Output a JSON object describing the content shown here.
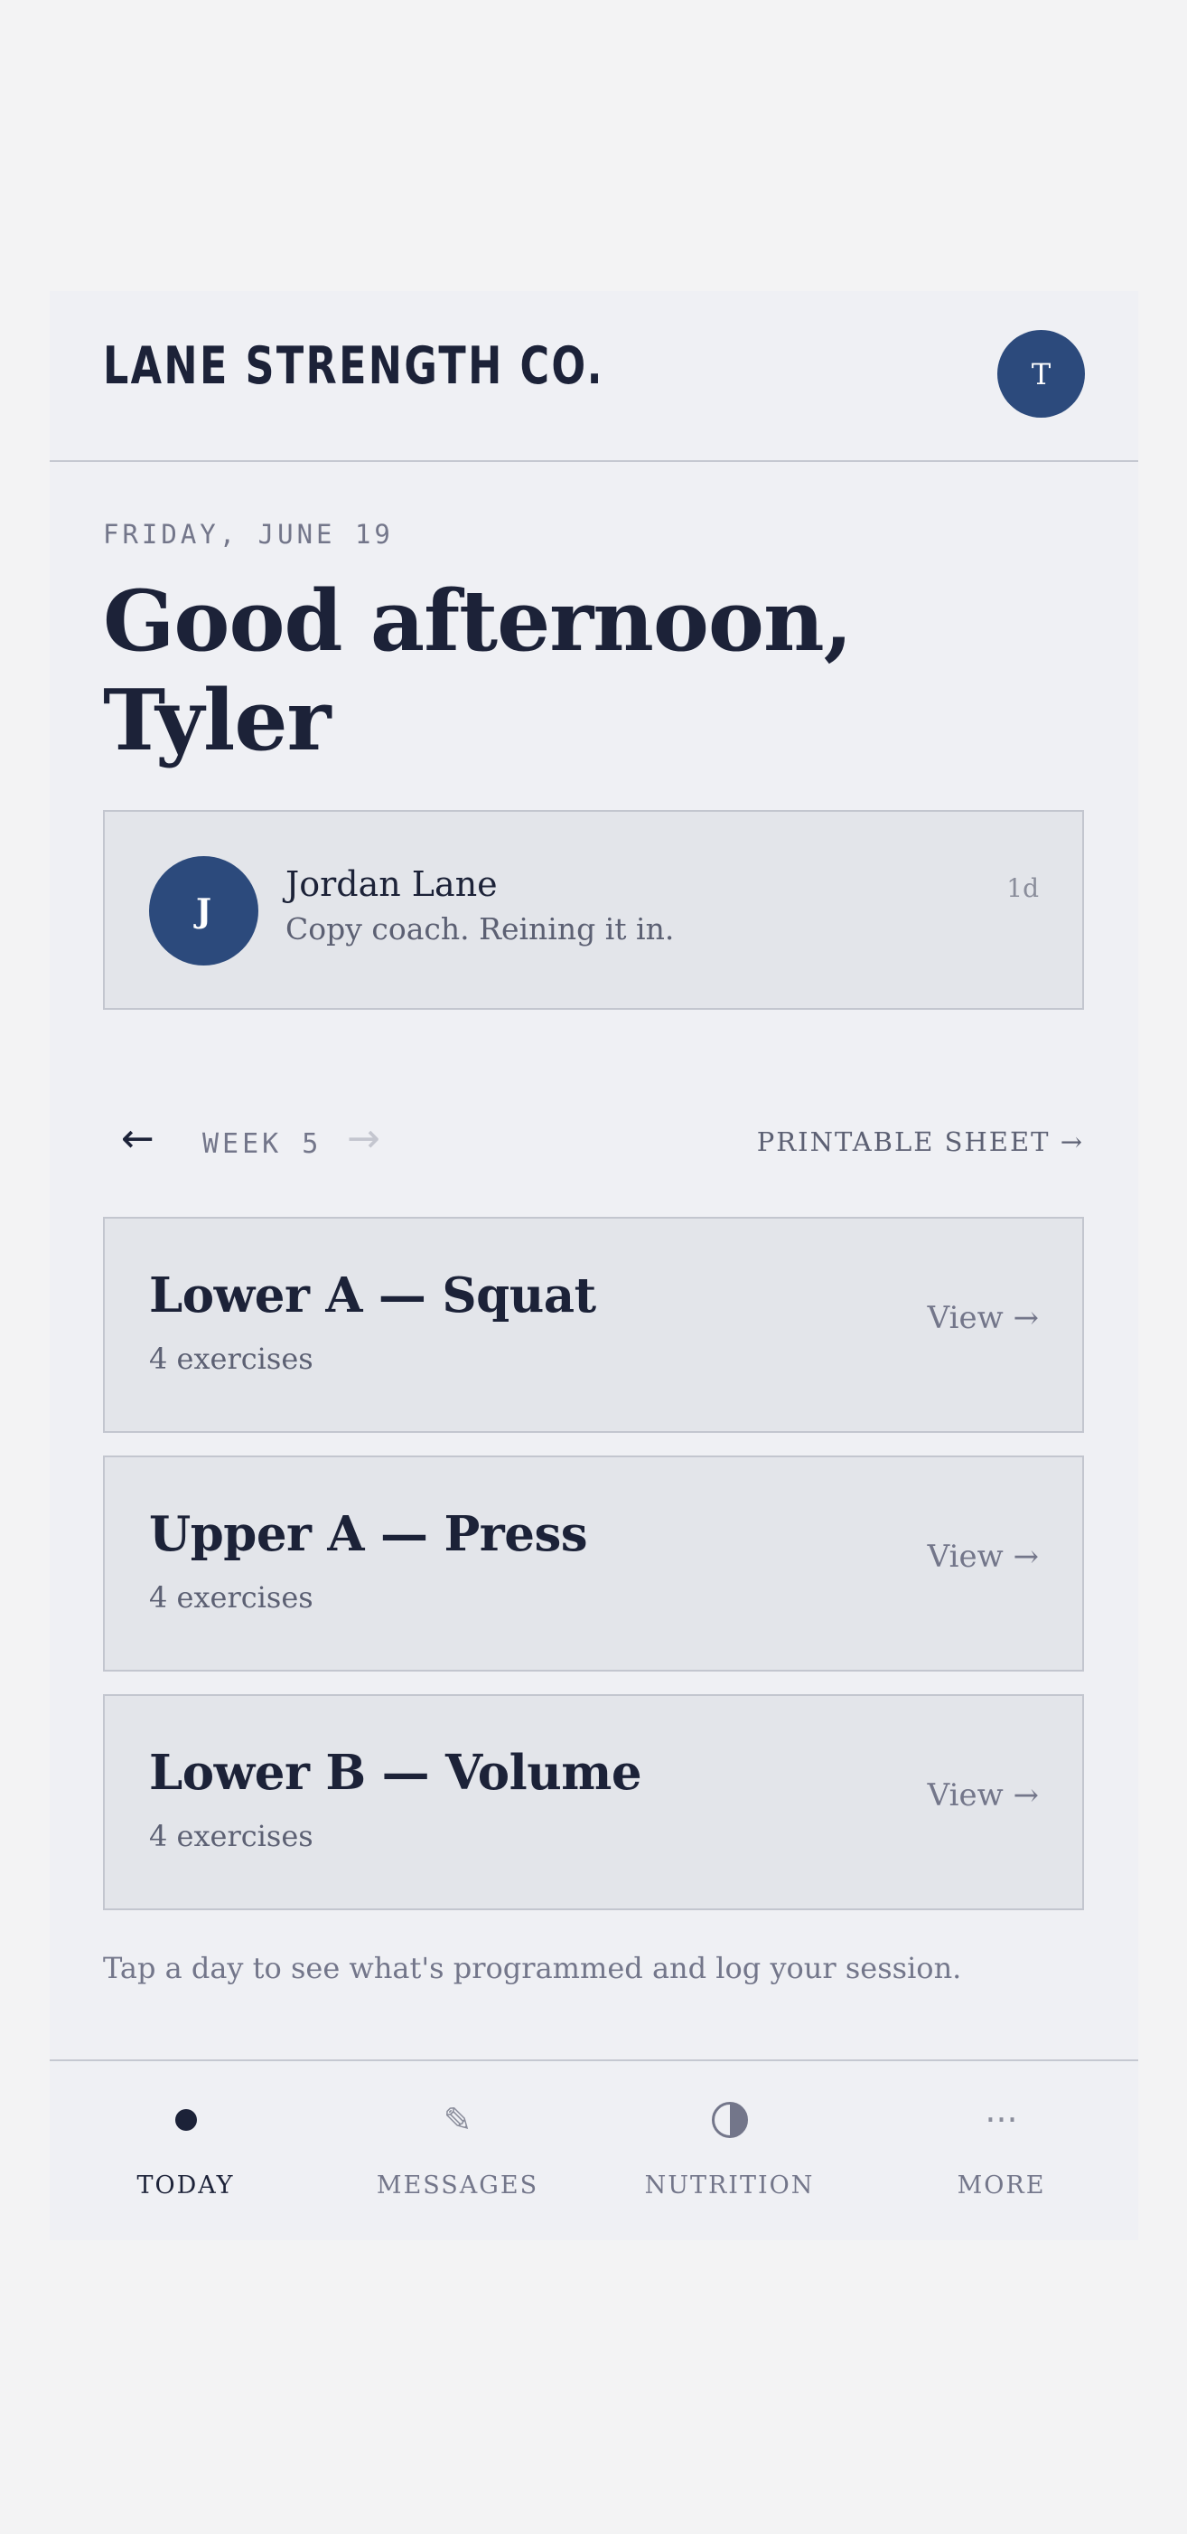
{
  "header": {
    "brand": "LANE STRENGTH CO.",
    "avatar_initial": "T"
  },
  "greeting": {
    "date": "FRIDAY, JUNE 19",
    "line1": "Good afternoon,",
    "line2": "Tyler"
  },
  "message": {
    "avatar_initial": "J",
    "sender": "Jordan Lane",
    "text": "Copy coach. Reining it in.",
    "time": "1d"
  },
  "week_nav": {
    "prev_icon": "←",
    "label": "WEEK 5",
    "next_icon": "→",
    "printable_label": "PRINTABLE SHEET →"
  },
  "workouts": [
    {
      "title": "Lower A — Squat",
      "subtitle": "4 exercises",
      "action": "View →"
    },
    {
      "title": "Upper A — Press",
      "subtitle": "4 exercises",
      "action": "View →"
    },
    {
      "title": "Lower B — Volume",
      "subtitle": "4 exercises",
      "action": "View →"
    }
  ],
  "hint": "Tap a day to see what's programmed and log your session.",
  "tabs": [
    {
      "label": "TODAY",
      "icon": "dot-icon",
      "active": true
    },
    {
      "label": "MESSAGES",
      "icon": "pencil-icon",
      "glyph": "✎",
      "active": false
    },
    {
      "label": "NUTRITION",
      "icon": "half-circle-icon",
      "active": false
    },
    {
      "label": "MORE",
      "icon": "more-icon",
      "glyph": "···",
      "active": false
    }
  ],
  "colors": {
    "page_bg": "#f3f3f4",
    "app_bg": "#eff0f4",
    "card_bg": "#e3e5ea",
    "ink": "#1c2238",
    "accent": "#2c4a7c",
    "muted": "#73768a"
  }
}
